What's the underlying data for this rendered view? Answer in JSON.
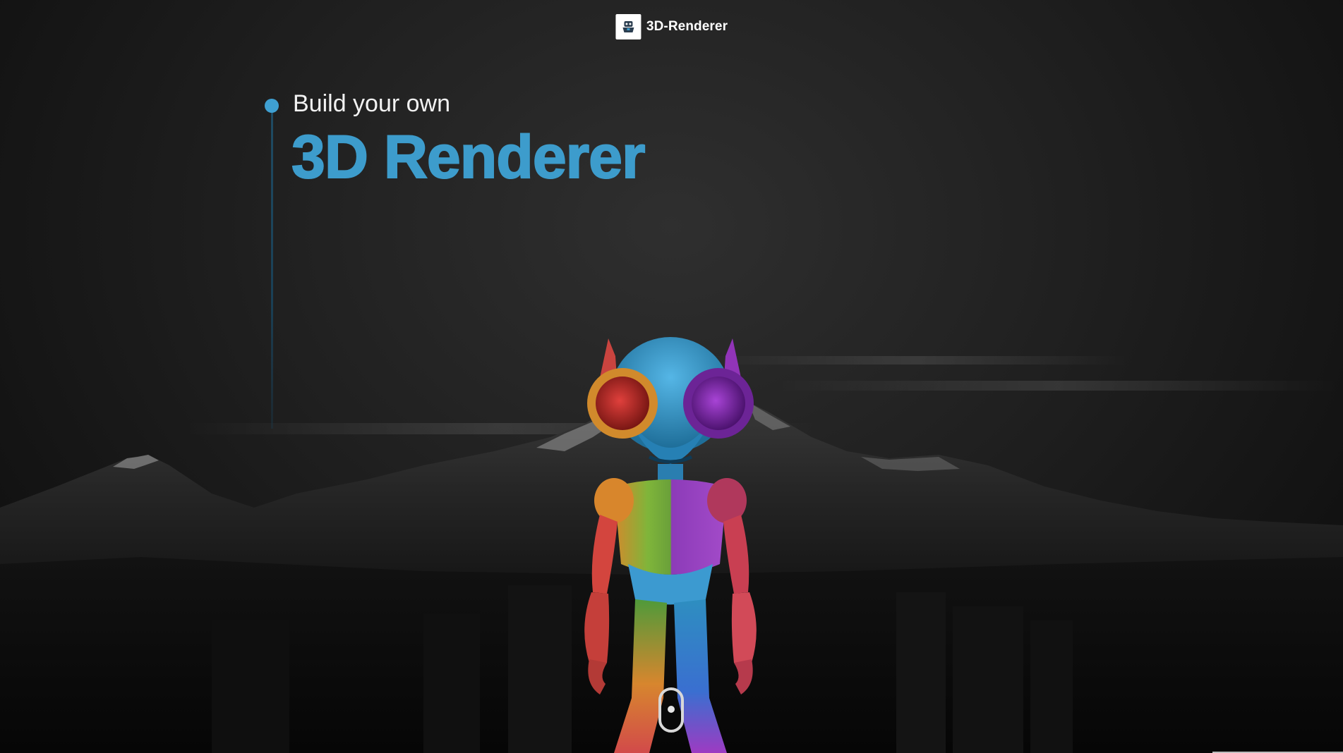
{
  "header": {
    "brand_name": "3D-Renderer",
    "logo_icon": "robot-logo-icon"
  },
  "hero": {
    "subtitle": "Build your own",
    "title": "3D Renderer",
    "accent_color": "#3d9ccc"
  },
  "scroll_indicator": {
    "icon": "mouse-scroll-icon"
  },
  "colors": {
    "background": "#1b1b1b",
    "accent": "#3d9ccc",
    "text": "#ffffff"
  }
}
